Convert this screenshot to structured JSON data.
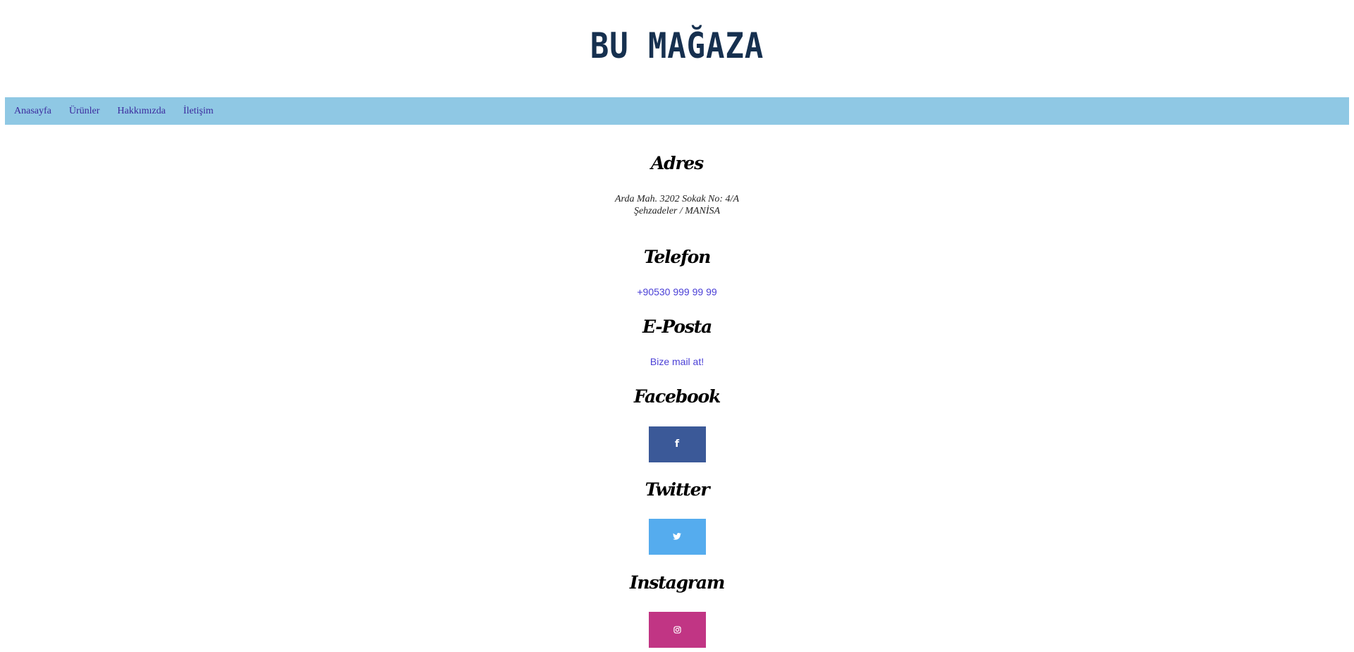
{
  "header": {
    "logo_text": "BU MAĞAZA"
  },
  "nav": {
    "items": [
      {
        "label": "Anasayfa"
      },
      {
        "label": "Ürünler"
      },
      {
        "label": "Hakkımızda"
      },
      {
        "label": "İletişim"
      }
    ]
  },
  "contact": {
    "address": {
      "title": "Adres",
      "line1": "Arda Mah. 3202 Sokak No: 4/A",
      "line2": "Şehzadeler / MANİSA"
    },
    "phone": {
      "title": "Telefon",
      "value": "+90530 999 99 99"
    },
    "email": {
      "title": "E-Posta",
      "link_text": "Bize mail at!"
    },
    "facebook": {
      "title": "Facebook",
      "icon": "facebook-icon",
      "color": "#3b5998"
    },
    "twitter": {
      "title": "Twitter",
      "icon": "twitter-icon",
      "color": "#55acee"
    },
    "instagram": {
      "title": "Instagram",
      "icon": "instagram-icon",
      "color": "#c13584"
    }
  }
}
